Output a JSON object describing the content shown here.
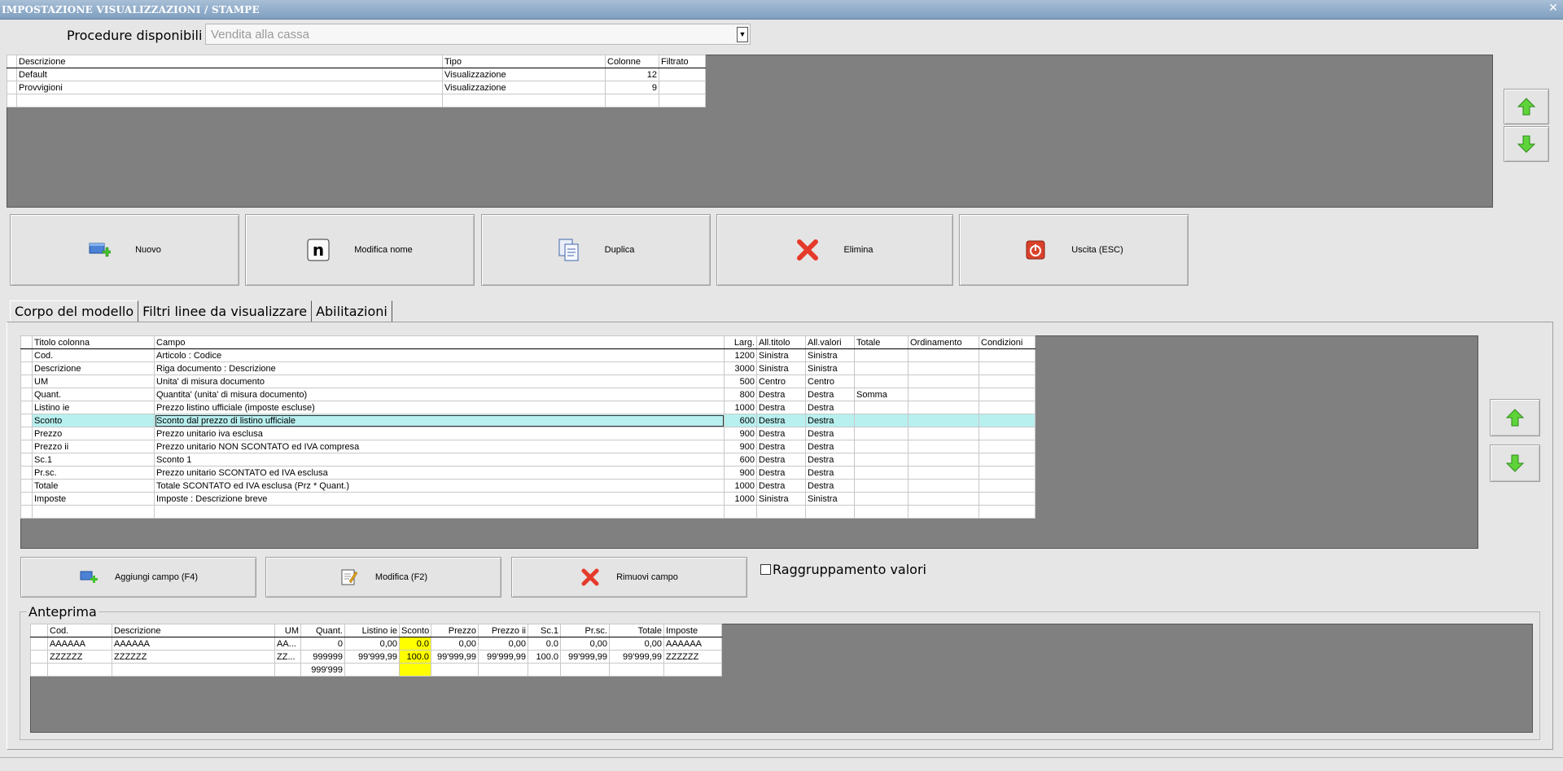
{
  "window": {
    "title": "IMPOSTAZIONE VISUALIZZAZIONI / STAMPE"
  },
  "procedure": {
    "label": "Procedure disponibili :",
    "value": "Vendita alla cassa"
  },
  "models_table": {
    "headers": [
      "Descrizione",
      "Tipo",
      "Colonne",
      "Filtrato"
    ],
    "rows": [
      [
        "Default",
        "Visualizzazione",
        "12",
        ""
      ],
      [
        "Provvigioni",
        "Visualizzazione",
        "9",
        ""
      ],
      [
        "",
        "",
        "",
        ""
      ]
    ]
  },
  "model_buttons": {
    "new": "Nuovo",
    "rename": "Modifica nome",
    "duplicate": "Duplica",
    "delete": "Elimina",
    "exit": "Uscita (ESC)"
  },
  "tabs": [
    "Corpo del modello",
    "Filtri linee da visualizzare",
    "Abilitazioni"
  ],
  "columns_table": {
    "headers": [
      "Titolo colonna",
      "Campo",
      "Larg.",
      "All.titolo",
      "All.valori",
      "Totale",
      "Ordinamento",
      "Condizioni"
    ],
    "rows": [
      [
        "Cod.",
        "Articolo : Codice",
        "1200",
        "Sinistra",
        "Sinistra",
        "",
        "",
        ""
      ],
      [
        "Descrizione",
        "Riga documento : Descrizione",
        "3000",
        "Sinistra",
        "Sinistra",
        "",
        "",
        ""
      ],
      [
        "UM",
        "Unita' di misura documento",
        "500",
        "Centro",
        "Centro",
        "",
        "",
        ""
      ],
      [
        "Quant.",
        "Quantita' (unita' di misura documento)",
        "800",
        "Destra",
        "Destra",
        "Somma",
        "",
        ""
      ],
      [
        "Listino ie",
        "Prezzo listino ufficiale (imposte escluse)",
        "1000",
        "Destra",
        "Destra",
        "",
        "",
        ""
      ],
      [
        "Sconto",
        "Sconto dal prezzo di listino ufficiale",
        "600",
        "Destra",
        "Destra",
        "",
        "",
        ""
      ],
      [
        "Prezzo",
        "Prezzo unitario iva esclusa",
        "900",
        "Destra",
        "Destra",
        "",
        "",
        ""
      ],
      [
        "Prezzo ii",
        "Prezzo unitario NON SCONTATO ed IVA compresa",
        "900",
        "Destra",
        "Destra",
        "",
        "",
        ""
      ],
      [
        "Sc.1",
        "Sconto 1",
        "600",
        "Destra",
        "Destra",
        "",
        "",
        ""
      ],
      [
        "Pr.sc.",
        "Prezzo unitario SCONTATO ed IVA esclusa",
        "900",
        "Destra",
        "Destra",
        "",
        "",
        ""
      ],
      [
        "Totale",
        "Totale SCONTATO ed IVA esclusa (Prz * Quant.)",
        "1000",
        "Destra",
        "Destra",
        "",
        "",
        ""
      ],
      [
        "Imposte",
        "Imposte : Descrizione breve",
        "1000",
        "Sinistra",
        "Sinistra",
        "",
        "",
        ""
      ],
      [
        "",
        "",
        "",
        "",
        "",
        "",
        "",
        ""
      ]
    ],
    "selected_row": 5
  },
  "field_buttons": {
    "add": "Aggiungi campo (F4)",
    "edit": "Modifica (F2)",
    "remove": "Rimuovi campo"
  },
  "grouping": {
    "label": "Raggruppamento valori",
    "checked": false
  },
  "preview": {
    "legend": "Anteprima",
    "headers": [
      "Cod.",
      "Descrizione",
      "UM",
      "Quant.",
      "Listino ie",
      "Sconto",
      "Prezzo",
      "Prezzo ii",
      "Sc.1",
      "Pr.sc.",
      "Totale",
      "Imposte"
    ],
    "rows": [
      [
        "AAAAAA",
        "AAAAAA",
        "AA...",
        "0",
        "0,00",
        "0.0",
        "0,00",
        "0,00",
        "0.0",
        "0,00",
        "0,00",
        "AAAAAA"
      ],
      [
        "ZZZZZZ",
        "ZZZZZZ",
        "ZZ...",
        "999999",
        "99'999,99",
        "100.0",
        "99'999,99",
        "99'999,99",
        "100.0",
        "99'999,99",
        "99'999,99",
        "ZZZZZZ"
      ],
      [
        "",
        "",
        "",
        "999'999",
        "",
        "",
        "",
        "",
        "",
        "",
        "",
        ""
      ]
    ],
    "highlight_column": 5
  },
  "colors": {
    "highlight_row": "#b8efef",
    "highlight_col": "#ffff00",
    "grid_background": "#808080"
  },
  "icons": [
    "close-icon",
    "new-icon",
    "rename-icon",
    "duplicate-icon",
    "delete-icon",
    "exit-icon",
    "arrow-up-icon",
    "arrow-down-icon",
    "add-field-icon",
    "edit-field-icon",
    "remove-field-icon"
  ]
}
